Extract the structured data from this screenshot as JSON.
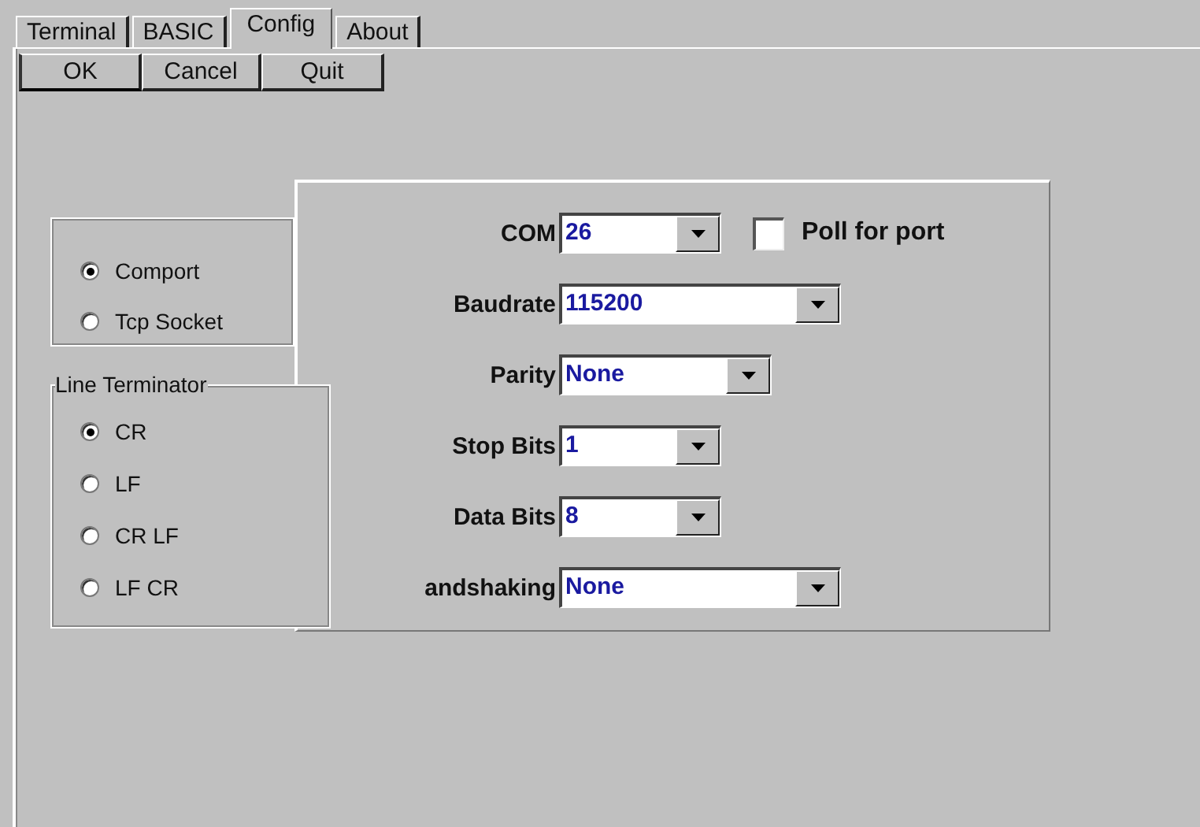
{
  "tabs": [
    {
      "label": "Terminal",
      "selected": false
    },
    {
      "label": "BASIC",
      "selected": false
    },
    {
      "label": "Config",
      "selected": true
    },
    {
      "label": "About",
      "selected": false
    }
  ],
  "buttons": [
    {
      "label": "OK",
      "default": true
    },
    {
      "label": "Cancel",
      "default": false
    },
    {
      "label": "Quit",
      "default": false
    }
  ],
  "connection": {
    "options": [
      {
        "label": "Comport",
        "selected": true
      },
      {
        "label": "Tcp Socket",
        "selected": false
      }
    ]
  },
  "line_terminator": {
    "title": "Line Terminator",
    "options": [
      {
        "label": "CR",
        "selected": true
      },
      {
        "label": "LF",
        "selected": false
      },
      {
        "label": "CR LF",
        "selected": false
      },
      {
        "label": "LF CR",
        "selected": false
      }
    ]
  },
  "port_settings": {
    "fields": [
      {
        "label": "COM",
        "value": "26"
      },
      {
        "label": "Baudrate",
        "value": "115200"
      },
      {
        "label": "Parity",
        "value": "None"
      },
      {
        "label": "Stop Bits",
        "value": "1"
      },
      {
        "label": "Data Bits",
        "value": "8"
      },
      {
        "label": "andshaking",
        "value": "None"
      }
    ],
    "poll": {
      "label": "Poll for port",
      "checked": false
    }
  }
}
